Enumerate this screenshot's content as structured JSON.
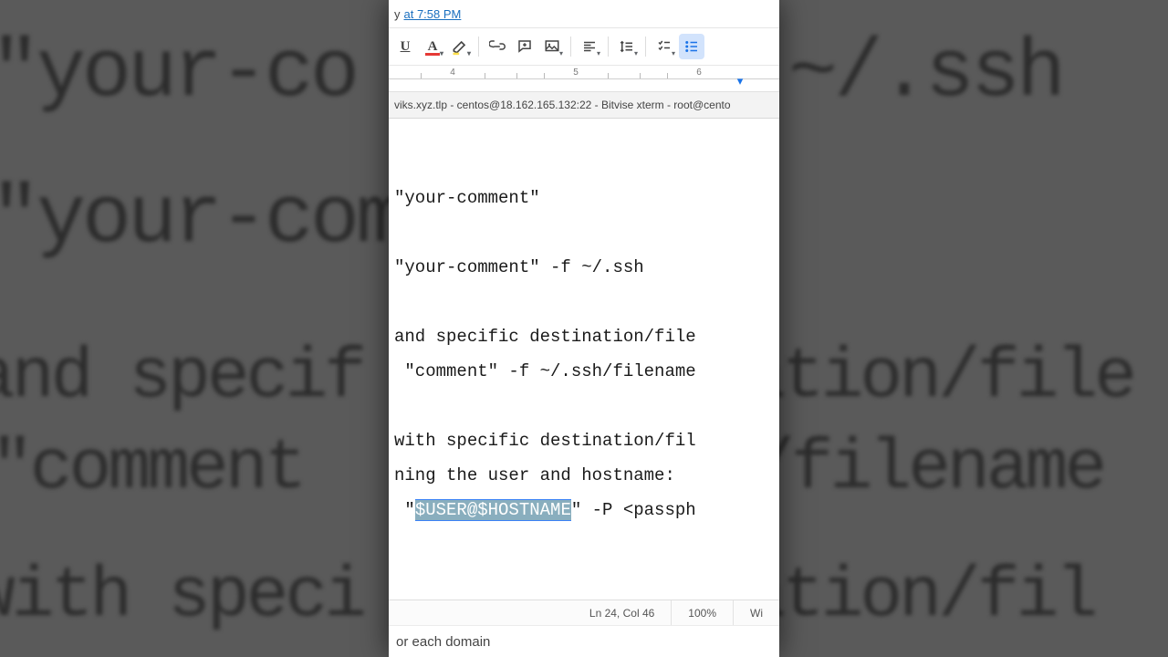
{
  "header": {
    "prefix": "y",
    "link": "at 7:58 PM"
  },
  "toolbar": {
    "underline": "U",
    "textcolor": "A",
    "link_icon": "link",
    "comment_icon": "comment",
    "image_icon": "image",
    "align_icon": "align",
    "linesp_icon": "line-spacing",
    "checklist_icon": "checklist",
    "bullets_icon": "bulleted-list"
  },
  "ruler": {
    "n4": "4",
    "n5": "5",
    "n6": "6"
  },
  "tabstrip": "viks.xyz.tlp - centos@18.162.165.132:22 - Bitvise xterm - root@cento",
  "doc": {
    "l1": "\"your-comment\"",
    "l2": "\"your-comment\" -f ~/.ssh",
    "l3": "and specific destination/file",
    "l4": " \"comment\" -f ~/.ssh/filename",
    "l5": "with specific destination/fil",
    "l6": "ning the user and hostname:",
    "l7a": " \"",
    "l7sel": "$USER@$HOSTNAME",
    "l7b": "\" -P <passph"
  },
  "status": {
    "pos": "Ln 24, Col 46",
    "zoom": "100%",
    "enc": "Wi"
  },
  "footer": "or each domain",
  "bg": {
    "l1": "\"your-co",
    "l2": "\"your-com",
    "l3": "and specif",
    "l4": " \"comment",
    "l5": "with speci",
    "r1": "~/.ssh",
    "r2": "ation/file",
    "r3": "/filename",
    "r4": "ation/fil"
  }
}
